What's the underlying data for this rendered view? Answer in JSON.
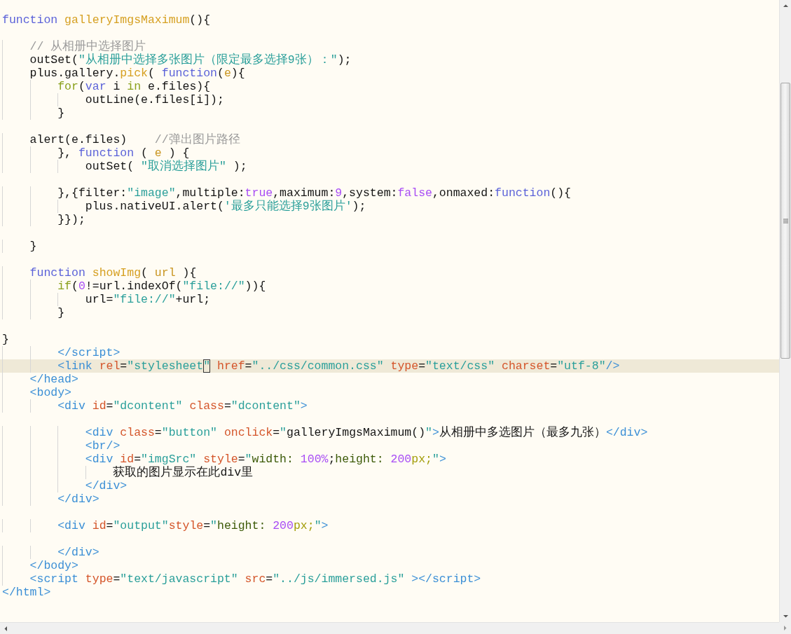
{
  "editor": {
    "blocks": [
      [
        {
          "tokens": [
            {
              "kind": "kw",
              "text": "function"
            },
            {
              "kind": "fn",
              "text": " galleryImgsMaximum"
            },
            {
              "kind": "plain",
              "text": "(){"
            }
          ]
        }
      ],
      [
        {
          "tokens": [
            {
              "kind": "cmt",
              "text": "    // 从相册中选择图片"
            }
          ]
        },
        {
          "tokens": [
            {
              "kind": "plain",
              "text": "    outSet("
            },
            {
              "kind": "str",
              "text": "\"从相册中选择多张图片（限定最多选择9张）：\""
            },
            {
              "kind": "plain",
              "text": ");"
            }
          ]
        },
        {
          "tokens": [
            {
              "kind": "plain",
              "text": "    plus.gallery."
            },
            {
              "kind": "fn",
              "text": "pick"
            },
            {
              "kind": "plain",
              "text": "( "
            },
            {
              "kind": "kw",
              "text": "function"
            },
            {
              "kind": "plain",
              "text": "("
            },
            {
              "kind": "param",
              "text": "e"
            },
            {
              "kind": "plain",
              "text": "){"
            }
          ]
        },
        {
          "tokens": [
            {
              "kind": "ctl",
              "text": "        for"
            },
            {
              "kind": "plain",
              "text": "("
            },
            {
              "kind": "kw",
              "text": "var"
            },
            {
              "kind": "plain",
              "text": " i "
            },
            {
              "kind": "ctl",
              "text": "in"
            },
            {
              "kind": "plain",
              "text": " e.files){"
            }
          ]
        },
        {
          "tokens": [
            {
              "kind": "plain",
              "text": "            outLine(e.files[i]);"
            }
          ]
        },
        {
          "tokens": [
            {
              "kind": "plain",
              "text": "        }"
            }
          ]
        }
      ],
      [
        {
          "tokens": [
            {
              "kind": "plain",
              "text": "    alert(e.files)    "
            },
            {
              "kind": "cmt",
              "text": "//弹出图片路径"
            }
          ]
        },
        {
          "tokens": [
            {
              "kind": "plain",
              "text": "        }, "
            },
            {
              "kind": "kw",
              "text": "function"
            },
            {
              "kind": "plain",
              "text": " ( "
            },
            {
              "kind": "param",
              "text": "e"
            },
            {
              "kind": "plain",
              "text": " ) {"
            }
          ]
        },
        {
          "tokens": [
            {
              "kind": "plain",
              "text": "            outSet( "
            },
            {
              "kind": "str",
              "text": "\"取消选择图片\""
            },
            {
              "kind": "plain",
              "text": " );"
            }
          ]
        }
      ],
      [
        {
          "tokens": [
            {
              "kind": "plain",
              "text": "        },{filter:"
            },
            {
              "kind": "str",
              "text": "\"image\""
            },
            {
              "kind": "plain",
              "text": ",multiple:"
            },
            {
              "kind": "num",
              "text": "true"
            },
            {
              "kind": "plain",
              "text": ",maximum:"
            },
            {
              "kind": "num",
              "text": "9"
            },
            {
              "kind": "plain",
              "text": ",system:"
            },
            {
              "kind": "num",
              "text": "false"
            },
            {
              "kind": "plain",
              "text": ",onmaxed:"
            },
            {
              "kind": "kw",
              "text": "function"
            },
            {
              "kind": "plain",
              "text": "(){"
            }
          ]
        },
        {
          "tokens": [
            {
              "kind": "plain",
              "text": "            plus.nativeUI.alert("
            },
            {
              "kind": "str",
              "text": "'最多只能选择9张图片'"
            },
            {
              "kind": "plain",
              "text": ");"
            }
          ]
        },
        {
          "tokens": [
            {
              "kind": "plain",
              "text": "        }});"
            }
          ]
        }
      ],
      [
        {
          "tokens": [
            {
              "kind": "plain",
              "text": "    }"
            }
          ]
        }
      ],
      [
        {
          "tokens": [
            {
              "kind": "kw",
              "text": "    function"
            },
            {
              "kind": "fn",
              "text": " showImg"
            },
            {
              "kind": "plain",
              "text": "( "
            },
            {
              "kind": "param",
              "text": "url"
            },
            {
              "kind": "plain",
              "text": " ){"
            }
          ]
        },
        {
          "tokens": [
            {
              "kind": "ctl",
              "text": "        if"
            },
            {
              "kind": "plain",
              "text": "("
            },
            {
              "kind": "num",
              "text": "0"
            },
            {
              "kind": "plain",
              "text": "!=url.indexOf("
            },
            {
              "kind": "str",
              "text": "\"file://\""
            },
            {
              "kind": "plain",
              "text": ")){"
            }
          ]
        },
        {
          "tokens": [
            {
              "kind": "plain",
              "text": "            url="
            },
            {
              "kind": "str",
              "text": "\"file://\""
            },
            {
              "kind": "plain",
              "text": "+url;"
            }
          ]
        },
        {
          "tokens": [
            {
              "kind": "plain",
              "text": "        }"
            }
          ]
        }
      ],
      [
        {
          "tokens": [
            {
              "kind": "plain",
              "text": "}"
            }
          ]
        },
        {
          "tokens": [
            {
              "kind": "tag",
              "text": "        </script>"
            }
          ]
        },
        {
          "current": true,
          "tokens": [
            {
              "kind": "tag",
              "text": "        <link"
            },
            {
              "kind": "attr",
              "text": " rel"
            },
            {
              "kind": "plain",
              "text": "="
            },
            {
              "kind": "str",
              "text": "\"stylesheet"
            },
            {
              "kind": "str",
              "text": "\"",
              "boxed": true
            },
            {
              "kind": "attr",
              "text": " href"
            },
            {
              "kind": "plain",
              "text": "="
            },
            {
              "kind": "str",
              "text": "\"../css/common.css\""
            },
            {
              "kind": "attr",
              "text": " type"
            },
            {
              "kind": "plain",
              "text": "="
            },
            {
              "kind": "str",
              "text": "\"text/css\""
            },
            {
              "kind": "attr",
              "text": " charset"
            },
            {
              "kind": "plain",
              "text": "="
            },
            {
              "kind": "str",
              "text": "\"utf-8\""
            },
            {
              "kind": "tag",
              "text": "/>"
            }
          ]
        },
        {
          "tokens": [
            {
              "kind": "tag",
              "text": "    </head>"
            }
          ]
        },
        {
          "tokens": [
            {
              "kind": "tag",
              "text": "    <body>"
            }
          ]
        },
        {
          "tokens": [
            {
              "kind": "tag",
              "text": "        <div"
            },
            {
              "kind": "attr",
              "text": " id"
            },
            {
              "kind": "plain",
              "text": "="
            },
            {
              "kind": "str",
              "text": "\"dcontent\""
            },
            {
              "kind": "attr",
              "text": " class"
            },
            {
              "kind": "plain",
              "text": "="
            },
            {
              "kind": "str",
              "text": "\"dcontent\""
            },
            {
              "kind": "tag",
              "text": ">"
            }
          ]
        }
      ],
      [
        {
          "tokens": [
            {
              "kind": "tag",
              "text": "            <div"
            },
            {
              "kind": "attr",
              "text": " class"
            },
            {
              "kind": "plain",
              "text": "="
            },
            {
              "kind": "str",
              "text": "\"button\""
            },
            {
              "kind": "attr",
              "text": " onclick"
            },
            {
              "kind": "plain",
              "text": "="
            },
            {
              "kind": "str",
              "text": "\""
            },
            {
              "kind": "plain",
              "text": "galleryImgsMaximum()"
            },
            {
              "kind": "str",
              "text": "\""
            },
            {
              "kind": "tag",
              "text": ">"
            },
            {
              "kind": "plain",
              "text": "从相册中多选图片（最多九张）"
            },
            {
              "kind": "tag",
              "text": "</div>"
            }
          ]
        },
        {
          "tokens": [
            {
              "kind": "tag",
              "text": "            <br/>"
            }
          ]
        },
        {
          "tokens": [
            {
              "kind": "tag",
              "text": "            <div"
            },
            {
              "kind": "attr",
              "text": " id"
            },
            {
              "kind": "plain",
              "text": "="
            },
            {
              "kind": "str",
              "text": "\"imgSrc\""
            },
            {
              "kind": "attr",
              "text": " style"
            },
            {
              "kind": "plain",
              "text": "="
            },
            {
              "kind": "str",
              "text": "\""
            },
            {
              "kind": "prop",
              "text": "width: "
            },
            {
              "kind": "num",
              "text": "100%"
            },
            {
              "kind": "plain",
              "text": ";"
            },
            {
              "kind": "prop",
              "text": "height: "
            },
            {
              "kind": "num",
              "text": "200"
            },
            {
              "kind": "unit",
              "text": "px;"
            },
            {
              "kind": "str",
              "text": "\""
            },
            {
              "kind": "tag",
              "text": ">"
            }
          ]
        },
        {
          "tokens": [
            {
              "kind": "plain",
              "text": "                获取的图片显示在此div里"
            }
          ]
        },
        {
          "tokens": [
            {
              "kind": "tag",
              "text": "            </div>"
            }
          ]
        },
        {
          "tokens": [
            {
              "kind": "tag",
              "text": "        </div>"
            }
          ]
        }
      ],
      [
        {
          "tokens": [
            {
              "kind": "tag",
              "text": "        <div"
            },
            {
              "kind": "attr",
              "text": " id"
            },
            {
              "kind": "plain",
              "text": "="
            },
            {
              "kind": "str",
              "text": "\"output\""
            },
            {
              "kind": "attr",
              "text": "style"
            },
            {
              "kind": "plain",
              "text": "="
            },
            {
              "kind": "str",
              "text": "\""
            },
            {
              "kind": "prop",
              "text": "height: "
            },
            {
              "kind": "num",
              "text": "200"
            },
            {
              "kind": "unit",
              "text": "px;"
            },
            {
              "kind": "str",
              "text": "\""
            },
            {
              "kind": "tag",
              "text": ">"
            }
          ]
        }
      ],
      [
        {
          "tokens": [
            {
              "kind": "tag",
              "text": "        </div>"
            }
          ]
        },
        {
          "tokens": [
            {
              "kind": "tag",
              "text": "    </body>"
            }
          ]
        },
        {
          "tokens": [
            {
              "kind": "tag",
              "text": "    <script"
            },
            {
              "kind": "attr",
              "text": " type"
            },
            {
              "kind": "plain",
              "text": "="
            },
            {
              "kind": "str",
              "text": "\"text/javascript\""
            },
            {
              "kind": "attr",
              "text": " src"
            },
            {
              "kind": "plain",
              "text": "="
            },
            {
              "kind": "str",
              "text": "\"../js/immersed.js\""
            },
            {
              "kind": "tag",
              "text": " ></script>"
            }
          ]
        },
        {
          "tokens": [
            {
              "kind": "tag",
              "text": "</html>"
            }
          ]
        }
      ]
    ]
  }
}
